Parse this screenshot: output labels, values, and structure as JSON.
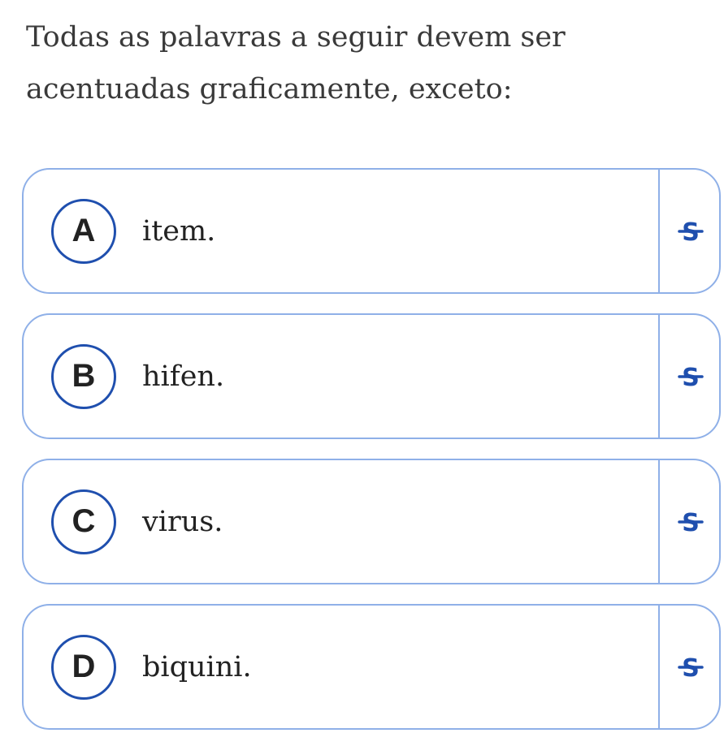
{
  "question": {
    "text": "Todas as palavras a seguir devem ser acentuadas graficamente, exceto:"
  },
  "options": [
    {
      "letter": "A",
      "text": "item.",
      "strike_icon": "strikethrough-icon"
    },
    {
      "letter": "B",
      "text": "hifen.",
      "strike_icon": "strikethrough-icon"
    },
    {
      "letter": "C",
      "text": "virus.",
      "strike_icon": "strikethrough-icon"
    },
    {
      "letter": "D",
      "text": "biquini.",
      "strike_icon": "strikethrough-icon"
    }
  ],
  "colors": {
    "accent": "#1f4fae",
    "border": "#8fb0e8",
    "text": "#222222"
  }
}
